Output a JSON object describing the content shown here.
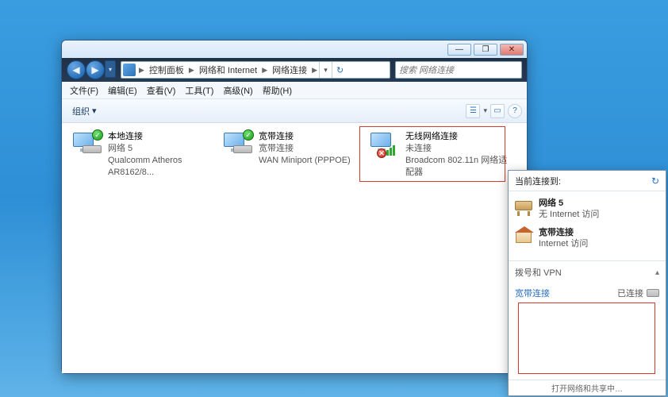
{
  "window": {
    "titlebar": {
      "min": "—",
      "max": "❐",
      "close": "✕"
    },
    "nav": {
      "back": "◀",
      "forward": "▶",
      "dropdown": "▾"
    },
    "breadcrumb": {
      "items": [
        "控制面板",
        "网络和 Internet",
        "网络连接"
      ],
      "sep": "▶",
      "dropdown": "▾",
      "refresh": "↻"
    },
    "search_placeholder": "搜索 网络连接",
    "menubar": [
      "文件(F)",
      "编辑(E)",
      "查看(V)",
      "工具(T)",
      "高级(N)",
      "帮助(H)"
    ],
    "toolbar": {
      "organize": "组织",
      "organize_drop": "▾",
      "view_drop": "▾",
      "help_icon": "?"
    }
  },
  "connections": [
    {
      "name": "本地连接",
      "status": "网络  5",
      "device": "Qualcomm Atheros AR8162/8...",
      "type": "ethernet",
      "badge": "check"
    },
    {
      "name": "宽带连接",
      "status": "宽带连接",
      "device": "WAN Miniport (PPPOE)",
      "type": "ppp",
      "badge": "check"
    },
    {
      "name": "无线网络连接",
      "status": "未连接",
      "device": "Broadcom 802.11n 网络适配器",
      "type": "wifi",
      "badge": "x"
    }
  ],
  "flyout": {
    "header": "当前连接到:",
    "refresh": "↻",
    "networks": [
      {
        "name": "网络  5",
        "sub": "无 Internet 访问",
        "icon": "bench"
      },
      {
        "name": "宽带连接",
        "sub": "Internet 访问",
        "icon": "house"
      }
    ],
    "section_label": "拨号和 VPN",
    "section_chev": "▴",
    "dial_item": {
      "name": "宽带连接",
      "status": "已连接"
    },
    "footer": "打开网络和共享中…"
  }
}
